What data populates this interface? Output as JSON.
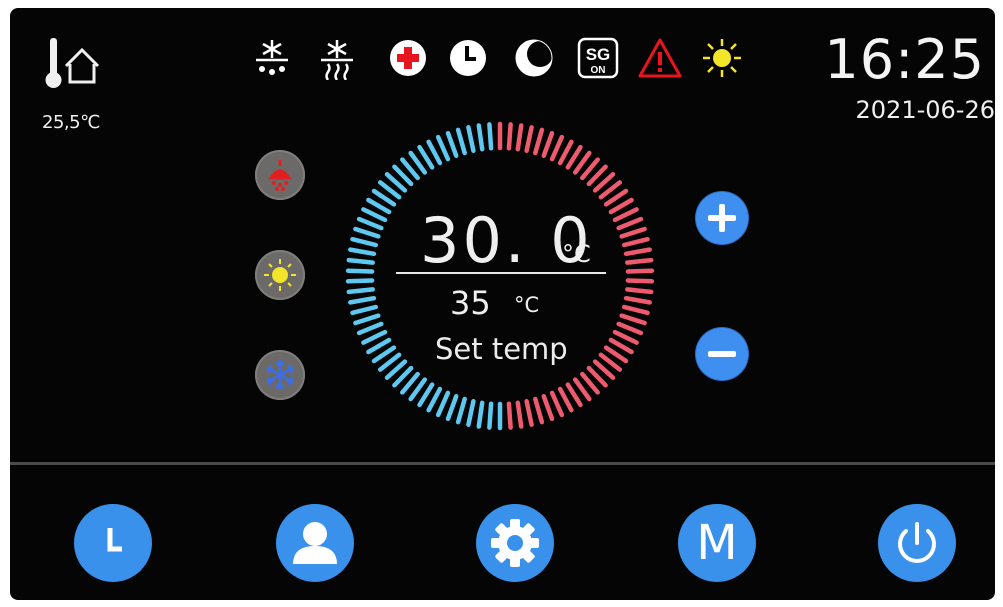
{
  "indoor": {
    "temperature": "25,5℃",
    "icon": "indoor-thermometer-house-icon"
  },
  "status_icons": [
    {
      "name": "defrost-drip-icon",
      "color": "#ffffff"
    },
    {
      "name": "defrost-heat-icon",
      "color": "#ffffff"
    },
    {
      "name": "medical-cross-icon",
      "color": "#e8141e"
    },
    {
      "name": "clock-timer-icon",
      "color": "#ffffff"
    },
    {
      "name": "moon-night-icon",
      "color": "#ffffff"
    },
    {
      "name": "sg-on-icon",
      "label_top": "SG",
      "label_bottom": "ON"
    },
    {
      "name": "warning-triangle-icon",
      "color": "#e8141e"
    },
    {
      "name": "sun-icon",
      "color": "#f2e52a"
    }
  ],
  "clock": {
    "time": "16:25",
    "date": "2021-06-26"
  },
  "modes": [
    {
      "name": "hot-water-mode-icon",
      "accent": "#e02020"
    },
    {
      "name": "heating-sun-mode-icon",
      "accent": "#f2e52a"
    },
    {
      "name": "cooling-snowflake-mode-icon",
      "accent": "#3b6ee8"
    }
  ],
  "dial": {
    "current_temp": "30. 0",
    "current_unit": "°C",
    "set_temp": "35",
    "set_unit": "°C",
    "set_label": "Set temp",
    "cool_color": "#5ec8f0",
    "warm_color": "#ee5a6e"
  },
  "controls": {
    "increase_icon": "plus-icon",
    "decrease_icon": "minus-icon"
  },
  "nav": [
    {
      "name": "nav-timer-button",
      "icon": "clock-icon"
    },
    {
      "name": "nav-user-button",
      "icon": "user-icon"
    },
    {
      "name": "nav-settings-button",
      "icon": "gear-icon"
    },
    {
      "name": "nav-mode-button",
      "label": "M"
    },
    {
      "name": "nav-power-button",
      "icon": "power-icon"
    }
  ],
  "colors": {
    "background": "#050505",
    "accent": "#3a91ec"
  }
}
